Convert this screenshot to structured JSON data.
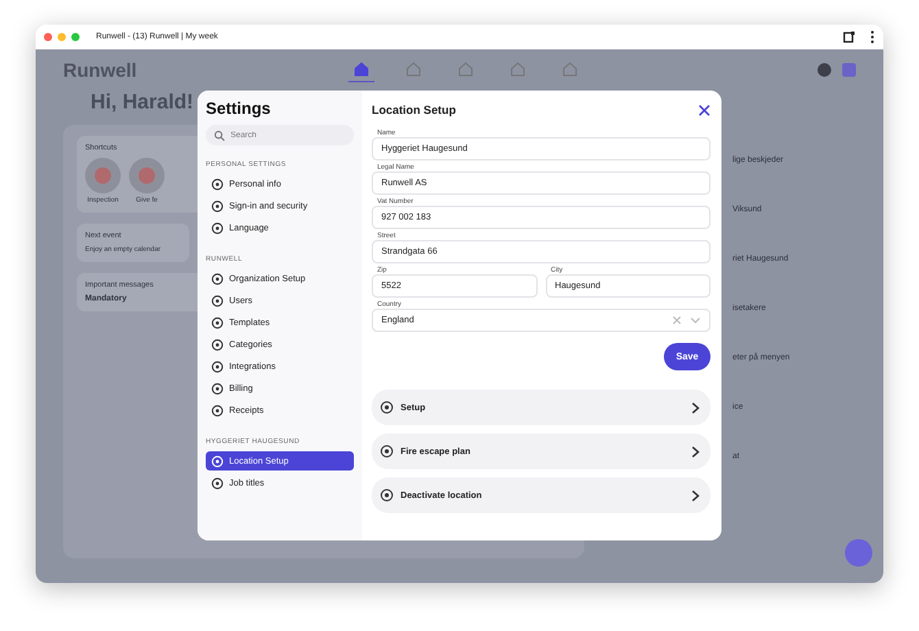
{
  "browser": {
    "title": "Runwell - (13) Runwell | My week"
  },
  "app": {
    "logo": "Runwell",
    "nav": [
      {
        "selected": true
      },
      {
        "selected": false
      },
      {
        "selected": false
      },
      {
        "selected": false
      },
      {
        "selected": false
      }
    ],
    "greeting": "Hi, Harald!",
    "shortcuts": {
      "title": "Shortcuts",
      "items": [
        "Inspection",
        "Give fe"
      ]
    },
    "next_event": {
      "title": "Next event",
      "text": "Enjoy an empty calendar"
    },
    "messages": {
      "title": "Important messages",
      "heading": "Mandatory"
    },
    "list": [
      "lige beskjeder",
      "Viksund",
      "riet Haugesund",
      "isetakere",
      "eter på menyen",
      "ice",
      "at"
    ]
  },
  "settings": {
    "title": "Settings",
    "search": {
      "placeholder": "Search"
    },
    "sections": [
      {
        "title": "PERSONAL SETTINGS",
        "items": [
          {
            "label": "Personal info",
            "selected": false
          },
          {
            "label": "Sign-in and security",
            "selected": false
          },
          {
            "label": "Language",
            "selected": false
          }
        ]
      },
      {
        "title": "RUNWELL",
        "items": [
          {
            "label": "Organization Setup",
            "selected": false
          },
          {
            "label": "Users",
            "selected": false
          },
          {
            "label": "Templates",
            "selected": false
          },
          {
            "label": "Categories",
            "selected": false
          },
          {
            "label": "Integrations",
            "selected": false
          },
          {
            "label": "Billing",
            "selected": false
          },
          {
            "label": "Receipts",
            "selected": false
          }
        ]
      },
      {
        "title": "HYGGERIET HAUGESUND",
        "items": [
          {
            "label": "Location Setup",
            "selected": true
          },
          {
            "label": "Job titles",
            "selected": false
          }
        ]
      }
    ]
  },
  "panel": {
    "title": "Location Setup",
    "fields": [
      {
        "label": "Name",
        "value": "Hyggeriet Haugesund"
      },
      {
        "label": "Legal Name",
        "value": "Runwell AS"
      },
      {
        "label": "Vat Number",
        "value": "927 002 183"
      },
      {
        "label": "Street",
        "value": "Strandgata 66"
      }
    ],
    "pair": [
      {
        "label": "Zip",
        "value": "5522"
      },
      {
        "label": "City",
        "value": "Haugesund"
      }
    ],
    "country": {
      "label": "Country",
      "value": "England"
    },
    "save": "Save",
    "actions": [
      {
        "label": "Setup"
      },
      {
        "label": "Fire escape plan"
      },
      {
        "label": "Deactivate location"
      }
    ]
  }
}
